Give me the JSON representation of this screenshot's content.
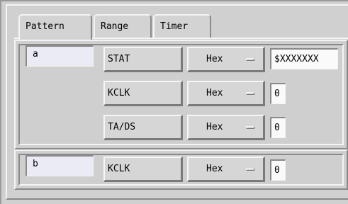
{
  "tabs": [
    "Pattern",
    "Range",
    "Timer"
  ],
  "active_tab": "Pattern",
  "groups": [
    {
      "name": "a",
      "rows": [
        {
          "label": "STAT",
          "format": "Hex",
          "value": "$XXXXXXX"
        },
        {
          "label": "KCLK",
          "format": "Hex",
          "value": "0"
        },
        {
          "label": "TA/DS",
          "format": "Hex",
          "value": "0"
        }
      ]
    },
    {
      "name": "b",
      "rows": [
        {
          "label": "KCLK",
          "format": "Hex",
          "value": "0"
        }
      ]
    }
  ]
}
